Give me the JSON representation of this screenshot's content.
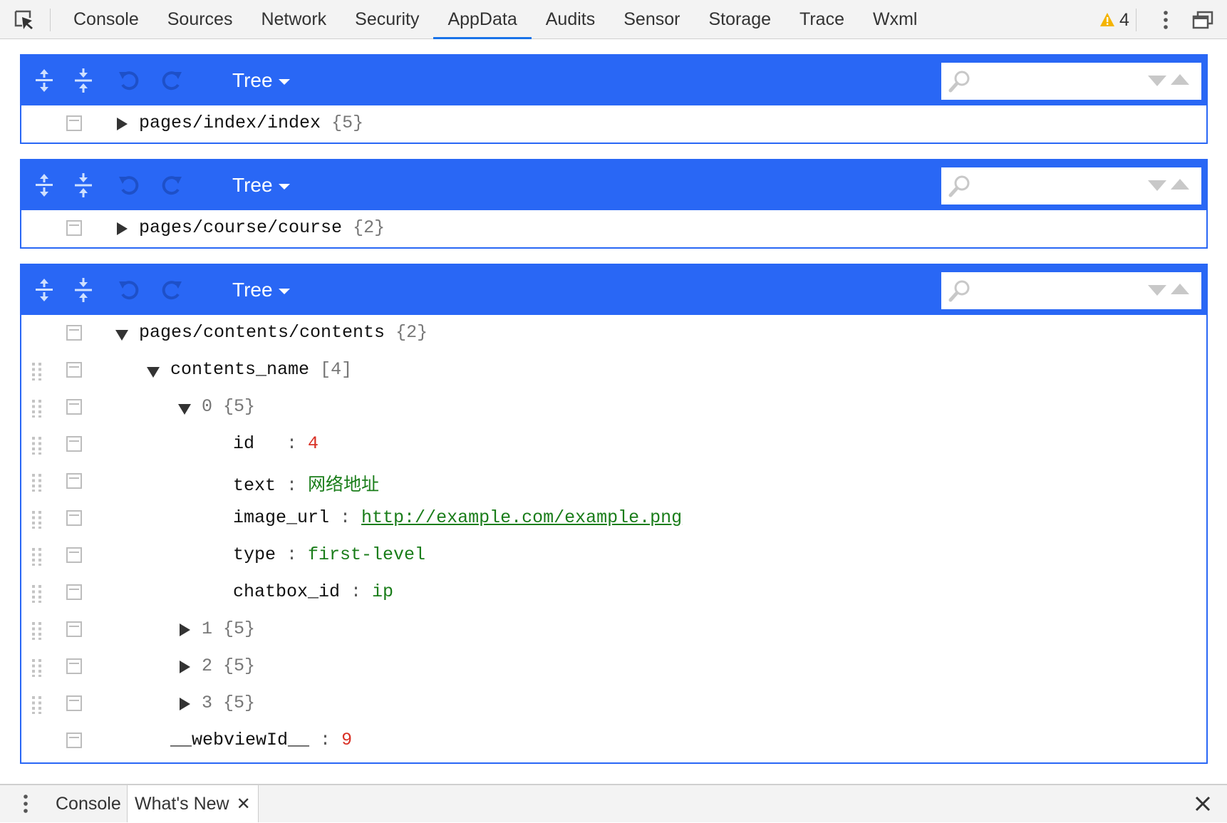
{
  "toolbar": {
    "tabs": [
      "Console",
      "Sources",
      "Network",
      "Security",
      "AppData",
      "Audits",
      "Sensor",
      "Storage",
      "Trace",
      "Wxml"
    ],
    "active_tab": "AppData",
    "warning_count": "4"
  },
  "panels": [
    {
      "mode_label": "Tree",
      "rows": [
        {
          "indent": 0,
          "toggle": "right",
          "key": "pages/index/index",
          "meta": "{5}",
          "grip": false
        }
      ]
    },
    {
      "mode_label": "Tree",
      "rows": [
        {
          "indent": 0,
          "toggle": "right",
          "key": "pages/course/course",
          "meta": "{2}",
          "grip": false
        }
      ]
    },
    {
      "mode_label": "Tree",
      "rows": [
        {
          "indent": 0,
          "toggle": "down",
          "key": "pages/contents/contents",
          "meta": "{2}",
          "grip": false
        },
        {
          "indent": 1,
          "toggle": "down",
          "key": "contents_name",
          "meta": "[4]",
          "grip": true
        },
        {
          "indent": 2,
          "toggle": "down",
          "key": "0",
          "meta": "{5}",
          "grip": true,
          "index": true
        },
        {
          "indent": 3,
          "toggle": "none",
          "key": "id",
          "pad": "  ",
          "value": "4",
          "vtype": "num",
          "grip": true
        },
        {
          "indent": 3,
          "toggle": "none",
          "key": "text",
          "value": "网络地址",
          "vtype": "str",
          "grip": true
        },
        {
          "indent": 3,
          "toggle": "none",
          "key": "image_url",
          "value": "http://example.com/example.png",
          "vtype": "link",
          "grip": true
        },
        {
          "indent": 3,
          "toggle": "none",
          "key": "type",
          "value": "first-level",
          "vtype": "str",
          "grip": true
        },
        {
          "indent": 3,
          "toggle": "none",
          "key": "chatbox_id",
          "value": "ip",
          "vtype": "str",
          "grip": true
        },
        {
          "indent": 2,
          "toggle": "right",
          "key": "1",
          "meta": "{5}",
          "grip": true,
          "index": true
        },
        {
          "indent": 2,
          "toggle": "right",
          "key": "2",
          "meta": "{5}",
          "grip": true,
          "index": true
        },
        {
          "indent": 2,
          "toggle": "right",
          "key": "3",
          "meta": "{5}",
          "grip": true,
          "index": true
        },
        {
          "indent": 1,
          "toggle": "none",
          "key": "__webviewId__",
          "value": "9",
          "vtype": "num",
          "grip": false
        }
      ]
    }
  ],
  "drawer": {
    "tabs": [
      "Console",
      "What's New"
    ],
    "active_tab": "What's New"
  },
  "colors": {
    "accent": "#2967f5",
    "number": "#d93025",
    "string": "#1a7d1a",
    "warning": "#f4b400"
  }
}
